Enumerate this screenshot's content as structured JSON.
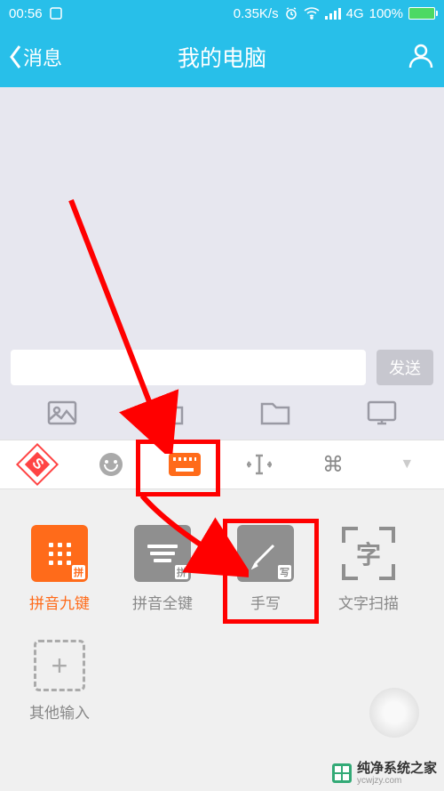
{
  "status": {
    "time": "00:56",
    "speed": "0.35K/s",
    "network": "4G",
    "battery": "100%"
  },
  "header": {
    "back_label": "消息",
    "title": "我的电脑"
  },
  "input": {
    "send_label": "发送"
  },
  "keyboard": {
    "logo_letter": "S"
  },
  "methods": {
    "pinyin9": "拼音九键",
    "pinyin_full": "拼音全键",
    "handwrite": "手写",
    "scan": "文字扫描",
    "other": "其他输入",
    "badge_pin": "拼",
    "badge_xie": "写",
    "scan_char": "字"
  },
  "watermark": {
    "title": "纯净系统之家",
    "url": "ycwjzy.com"
  }
}
